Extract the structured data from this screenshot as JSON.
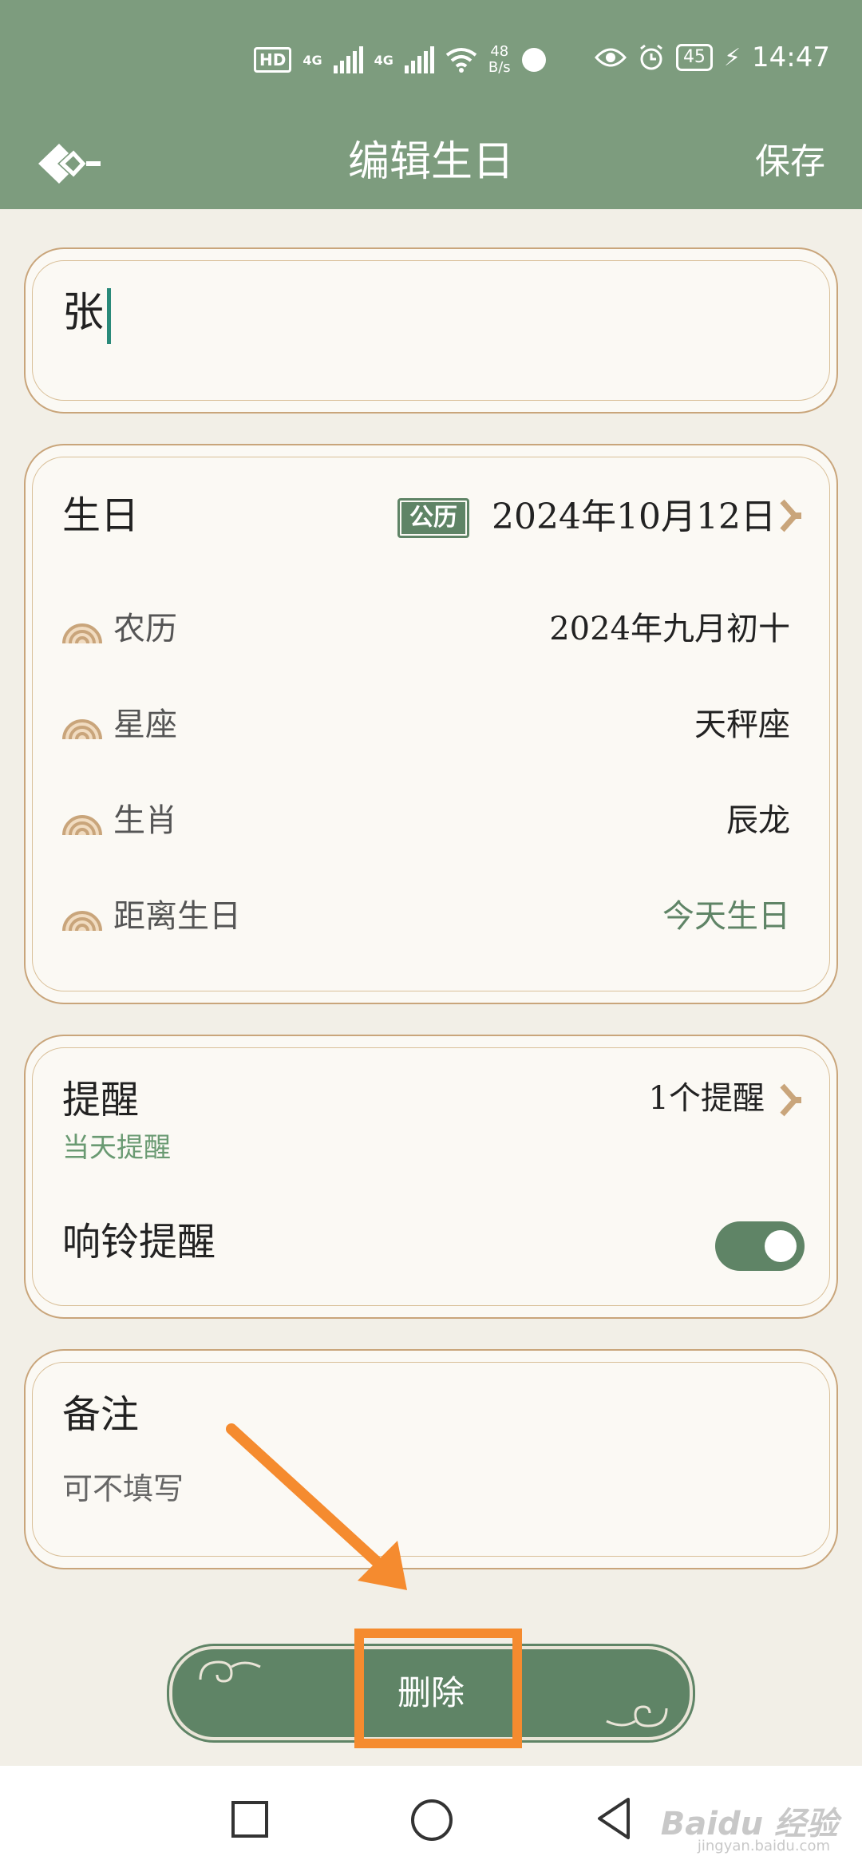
{
  "status": {
    "hd": "HD",
    "net1": "4G",
    "net2": "4G",
    "speed_value": "48",
    "speed_unit": "B/s",
    "battery": "45",
    "time": "14:47"
  },
  "appbar": {
    "title": "编辑生日",
    "save_label": "保存"
  },
  "name": {
    "value": "张"
  },
  "birthday": {
    "label": "生日",
    "calendar_badge": "公历",
    "date": "2024年10月12日",
    "rows": [
      {
        "label": "农历",
        "value": "2024年九月初十"
      },
      {
        "label": "星座",
        "value": "天秤座"
      },
      {
        "label": "生肖",
        "value": "辰龙"
      },
      {
        "label": "距离生日",
        "value": "今天生日"
      }
    ]
  },
  "reminder": {
    "label": "提醒",
    "sub": "当天提醒",
    "count": "1个提醒",
    "ring_label": "响铃提醒",
    "ring_enabled": true
  },
  "note": {
    "label": "备注",
    "placeholder": "可不填写"
  },
  "delete_label": "删除",
  "watermark": {
    "brand": "Baidu 经验",
    "url": "jingyan.baidu.com"
  },
  "colors": {
    "header": "#7d9c7e",
    "accent_green": "#5f8466",
    "card_border": "#c9a57b",
    "highlight": "#f58b2f"
  }
}
